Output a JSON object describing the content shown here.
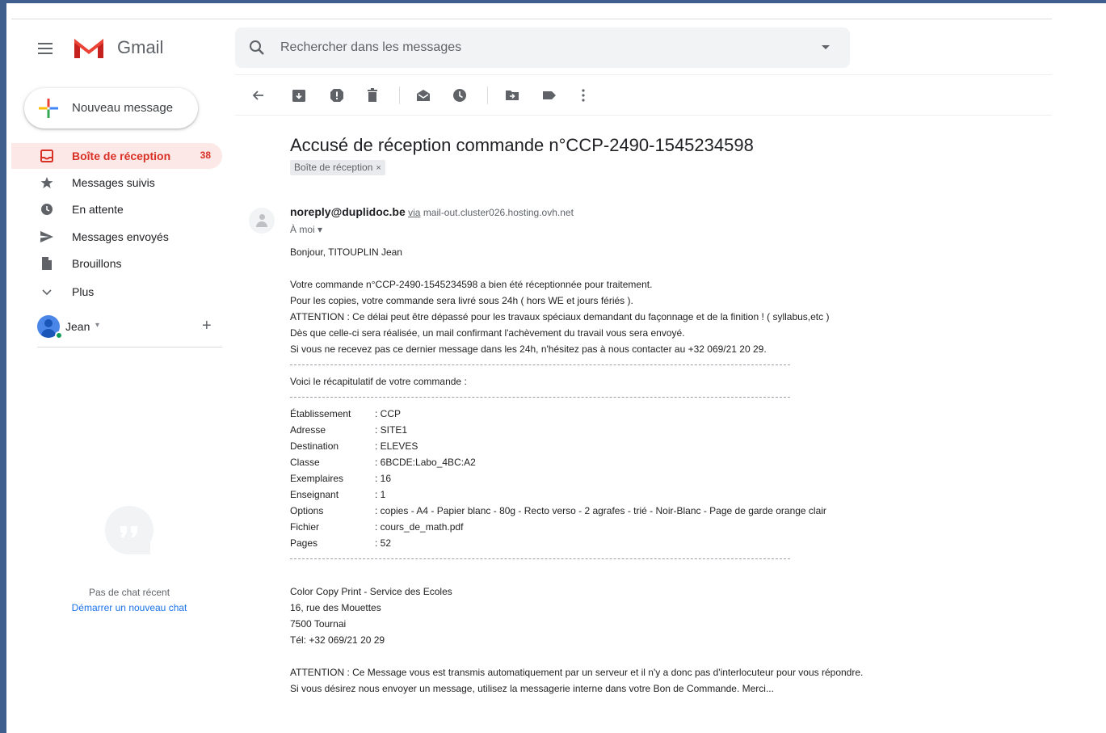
{
  "header": {
    "app_name": "Gmail",
    "search_placeholder": "Rechercher dans les messages"
  },
  "compose": {
    "label": "Nouveau message"
  },
  "sidebar": {
    "items": [
      {
        "label": "Boîte de réception",
        "count": "38",
        "icon": "inbox-icon",
        "active": true
      },
      {
        "label": "Messages suivis",
        "icon": "star-icon"
      },
      {
        "label": "En attente",
        "icon": "clock-icon"
      },
      {
        "label": "Messages envoyés",
        "icon": "send-icon"
      },
      {
        "label": "Brouillons",
        "icon": "draft-icon"
      },
      {
        "label": "Plus",
        "icon": "chevron-down-icon"
      }
    ],
    "account_name": "Jean",
    "account_caret": "▾",
    "account_add": "+"
  },
  "chat": {
    "empty_text": "Pas de chat récent",
    "start_link": "Démarrer un nouveau chat"
  },
  "toolbar": {
    "icons": [
      "back-icon",
      "archive-icon",
      "report-spam-icon",
      "delete-icon",
      "mark-unread-icon",
      "snooze-icon",
      "move-to-icon",
      "labels-icon",
      "more-icon"
    ]
  },
  "message": {
    "subject": "Accusé de réception commande n°CCP-2490-1545234598",
    "label_chip": "Boîte de réception",
    "label_chip_close": "×",
    "sender_email": "noreply@duplidoc.be",
    "sender_via_word": "via",
    "sender_via_host": "mail-out.cluster026.hosting.ovh.net",
    "to": "À moi ▾",
    "greeting": "Bonjour, TITOUPLIN Jean",
    "paragraph1": [
      "Votre commande n°CCP-2490-1545234598 a bien été réceptionnée pour traitement.",
      "Pour les copies, votre commande sera livré sous 24h ( hors WE et jours fériés ).",
      "ATTENTION : Ce délai peut être dépassé pour les travaux spéciaux demandant du façonnage et de la finition ! ( syllabus,etc )",
      "Dès que celle-ci sera réalisée, un mail confirmant l'achèvement du travail vous sera envoyé.",
      "Si vous ne recevez pas ce dernier message dans les 24h, n'hésitez pas à nous contacter au +32 069/21 20 29."
    ],
    "recap_title": "Voici le récapitulatif de votre commande :",
    "recap": [
      {
        "key": "Établissement",
        "value": ": CCP"
      },
      {
        "key": "Adresse",
        "value": ": SITE1"
      },
      {
        "key": "Destination",
        "value": ": ELEVES"
      },
      {
        "key": "Classe",
        "value": ": 6BCDE:Labo_4BC:A2"
      },
      {
        "key": "Exemplaires",
        "value": ": 16"
      },
      {
        "key": "Enseignant",
        "value": ": 1"
      },
      {
        "key": "Options",
        "value": ": copies - A4 - Papier blanc - 80g - Recto verso - 2 agrafes - trié - Noir-Blanc - Page de garde orange clair"
      },
      {
        "key": "Fichier",
        "value": ": cours_de_math.pdf"
      },
      {
        "key": "Pages",
        "value": ": 52"
      }
    ],
    "signature": [
      "Color Copy Print - Service des Ecoles",
      "16, rue des Mouettes",
      "7500 Tournai",
      "Tél: +32 069/21 20 29"
    ],
    "footer": [
      "ATTENTION : Ce Message vous est transmis automatiquement par un serveur et il n'y a donc pas d'interlocuteur pour vous répondre.",
      "Si vous désirez nous envoyer un message, utilisez la messagerie interne dans votre Bon de Commande. Merci..."
    ]
  },
  "colors": {
    "accent_red": "#d93025",
    "active_bg": "#fce8e6",
    "link_blue": "#1a73e8",
    "frame": "#3f5f8f"
  }
}
